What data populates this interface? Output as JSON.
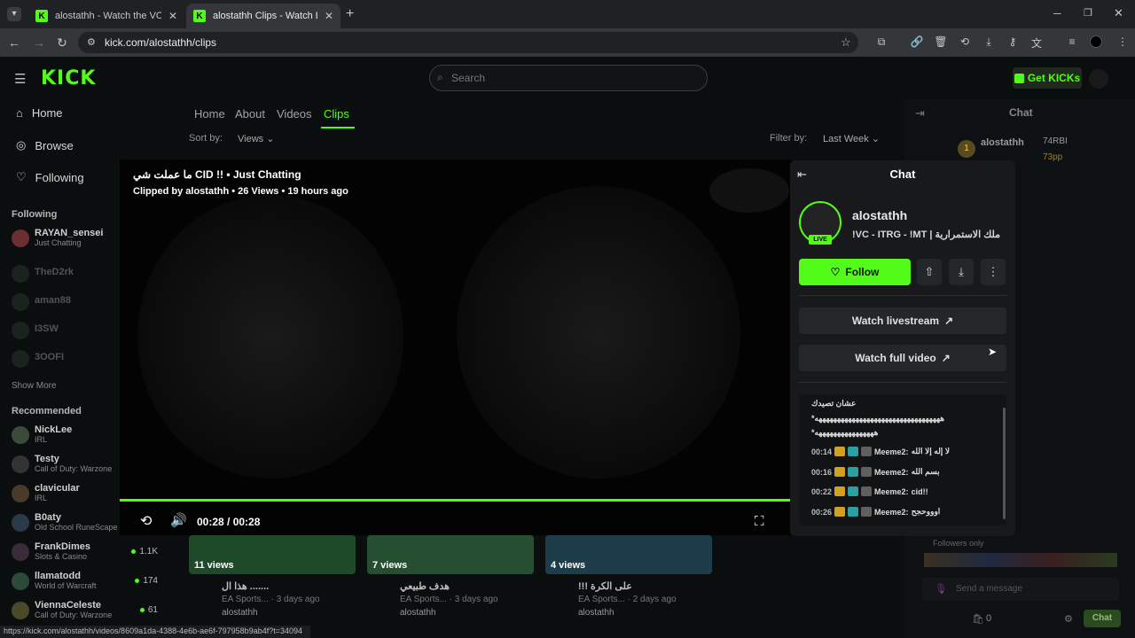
{
  "browser": {
    "tabs": [
      {
        "title": "alostathh - Watch the VOD on K"
      },
      {
        "title": "alostathh Clips - Watch Live on"
      }
    ],
    "url": "kick.com/alostathh/clips",
    "status_url": "https://kick.com/alostathh/videos/8609a1da-4388-4e6b-ae6f-797958b9ab4f?t=34094"
  },
  "header": {
    "logo": "KICK",
    "search_placeholder": "Search",
    "get_kicks": "Get KICKs"
  },
  "sidebar": {
    "nav": [
      {
        "label": "Home",
        "icon": "home-icon"
      },
      {
        "label": "Browse",
        "icon": "compass-icon"
      },
      {
        "label": "Following",
        "icon": "heart-icon"
      }
    ],
    "following_title": "Following",
    "following": [
      {
        "name": "RAYAN_sensei",
        "game": "Just Chatting"
      },
      {
        "name": "TheD2rk",
        "game": ""
      },
      {
        "name": "aman88",
        "game": ""
      },
      {
        "name": "I3SW",
        "game": ""
      },
      {
        "name": "3OOFI",
        "game": ""
      }
    ],
    "show_more": "Show More",
    "recommended_title": "Recommended",
    "recommended": [
      {
        "name": "NickLee",
        "game": "IRL",
        "viewers": ""
      },
      {
        "name": "Testy",
        "game": "Call of Duty: Warzone",
        "viewers": ""
      },
      {
        "name": "clavicular",
        "game": "IRL",
        "viewers": ""
      },
      {
        "name": "B0aty",
        "game": "Old School RuneScape",
        "viewers": ""
      },
      {
        "name": "FrankDimes",
        "game": "Slots & Casino",
        "viewers": "1.1K"
      },
      {
        "name": "llamatodd",
        "game": "World of Warcraft",
        "viewers": "174"
      },
      {
        "name": "ViennaCeleste",
        "game": "Call of Duty: Warzone",
        "viewers": "61"
      }
    ]
  },
  "main": {
    "tabs": [
      "Home",
      "About",
      "Videos",
      "Clips"
    ],
    "active_tab": "Clips",
    "sort_label": "Sort by:",
    "sort_value": "Views",
    "filter_label": "Filter by:",
    "filter_value": "Last Week"
  },
  "video": {
    "title": "ما عملت شي CID !! • Just Chatting",
    "sub": "Clipped by alostathh • 26 Views • 19 hours ago",
    "time": "00:28 / 00:28",
    "progress": 1.0
  },
  "clips": [
    {
      "views": "11 views",
      "title": "هذا ال .......",
      "meta": "EA Sports... · 3 days ago",
      "author": "alostathh"
    },
    {
      "views": "7 views",
      "title": "هدف طبيعي",
      "meta": "EA Sports... · 3 days ago",
      "author": "alostathh"
    },
    {
      "views": "4 views",
      "title": "!!! على الكرة",
      "meta": "EA Sports... · 2 days ago",
      "author": "alostathh"
    }
  ],
  "right_chat": {
    "title": "Chat",
    "leader": "alostathh",
    "rank_values": [
      "74RBI",
      "73pp"
    ],
    "send_placeholder": "Send a message",
    "chat_button": "Chat",
    "followers_only": "Followers only",
    "count": "0"
  },
  "popup": {
    "title": "Chat",
    "name": "alostathh",
    "tag": "!VC - ITRG - !MT | ملك الاستمرارية",
    "live": "LIVE",
    "follow": "Follow",
    "watch_live": "Watch livestream",
    "watch_full": "Watch full video",
    "messages": [
      {
        "time": "",
        "user": "",
        "text": "عشان تصيدك"
      },
      {
        "time": "",
        "user": "",
        "text": "*ههههههههههههههههههههههههههههههههههه"
      },
      {
        "time": "",
        "user": "",
        "text": "*ههههههههههههههههه"
      },
      {
        "time": "00:14",
        "user": "Meeme2:",
        "text": "لا إله إلا الله"
      },
      {
        "time": "00:16",
        "user": "Meeme2:",
        "text": "بسم الله"
      },
      {
        "time": "00:22",
        "user": "Meeme2:",
        "text": "cid!!"
      },
      {
        "time": "00:26",
        "user": "Meeme2:",
        "text": "اوووحجح"
      }
    ]
  },
  "colors": {
    "accent": "#53fc18",
    "bg": "#0b0e0f"
  }
}
